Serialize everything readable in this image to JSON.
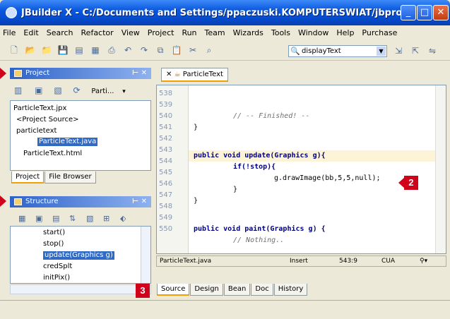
{
  "window": {
    "title": "JBuilder X - C:/Documents and Settings/ppaczuski.KOMPUTERSWIAT/jbproject/P...",
    "minimize": "_",
    "maximize": "□",
    "close": "✕"
  },
  "menu": [
    "File",
    "Edit",
    "Search",
    "Refactor",
    "View",
    "Project",
    "Run",
    "Team",
    "Wizards",
    "Tools",
    "Window",
    "Help",
    "Purchase"
  ],
  "toolbar": {
    "search_value": "displayText",
    "binoculars": "🔍"
  },
  "project_panel": {
    "title": "Project",
    "controls": "⊢ ✕",
    "toolbar_label": "Parti...",
    "tree": {
      "root": "ParticleText.jpx",
      "source": "<Project Source>",
      "package": "particletext",
      "file_java": "ParticleText.java",
      "file_html": "ParticleText.html"
    },
    "tabs": [
      "Project",
      "File Browser"
    ]
  },
  "structure_panel": {
    "title": "Structure",
    "controls": "⊢ ✕",
    "items": [
      "start()",
      "stop()",
      "update(Graphics g)",
      "credSplt",
      "initPix()"
    ]
  },
  "editor": {
    "tab": "ParticleText",
    "lines": [
      {
        "n": "538",
        "code": ""
      },
      {
        "n": "539",
        "code": ""
      },
      {
        "n": "540",
        "code": "// -- Finished! --"
      },
      {
        "n": "541",
        "code": "}"
      },
      {
        "n": "542",
        "code": ""
      },
      {
        "n": "543",
        "code": "public void update(Graphics g){"
      },
      {
        "n": "544",
        "code": "if(!stop){"
      },
      {
        "n": "545",
        "code": "g.drawImage(bb,5,5,null);"
      },
      {
        "n": "546",
        "code": "}"
      },
      {
        "n": "547",
        "code": "}"
      },
      {
        "n": "548",
        "code": ""
      },
      {
        "n": "549",
        "code": "public void paint(Graphics g) {"
      },
      {
        "n": "550",
        "code": "// Nothing.."
      }
    ]
  },
  "status": {
    "file": "ParticleText.java",
    "mode": "Insert",
    "position": "543:9",
    "keymap": "CUA"
  },
  "editor_tabs": [
    "Source",
    "Design",
    "Bean",
    "Doc",
    "History"
  ],
  "badges": [
    "2",
    "3"
  ],
  "colors": {
    "title": "#0a58e0",
    "selection": "#316ac5",
    "badge": "#d0021b"
  }
}
